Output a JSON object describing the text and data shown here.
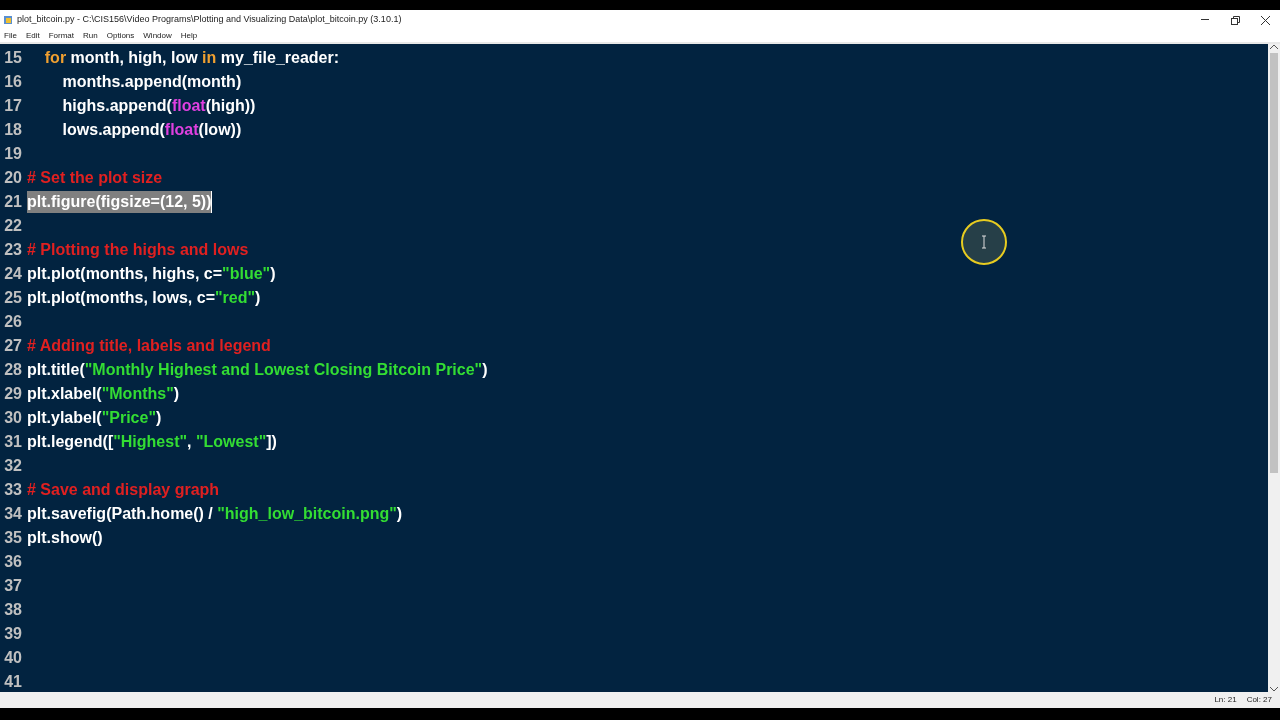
{
  "window": {
    "title": "plot_bitcoin.py - C:\\CIS156\\Video Programs\\Plotting and Visualizing Data\\plot_bitcoin.py (3.10.1)"
  },
  "menu": [
    "File",
    "Edit",
    "Format",
    "Run",
    "Options",
    "Window",
    "Help"
  ],
  "lines": [
    {
      "number": "15",
      "selected": false,
      "tokens": [
        {
          "kind": "keyword",
          "text": "    for"
        },
        {
          "kind": "plain",
          "text": " month, high, low "
        },
        {
          "kind": "keyword",
          "text": "in"
        },
        {
          "kind": "plain",
          "text": " my_file_reader:"
        }
      ]
    },
    {
      "number": "16",
      "selected": false,
      "tokens": [
        {
          "kind": "plain",
          "text": "        months.append(month)"
        }
      ]
    },
    {
      "number": "17",
      "selected": false,
      "tokens": [
        {
          "kind": "plain",
          "text": "        highs.append("
        },
        {
          "kind": "builtin",
          "text": "float"
        },
        {
          "kind": "plain",
          "text": "(high))"
        }
      ]
    },
    {
      "number": "18",
      "selected": false,
      "tokens": [
        {
          "kind": "plain",
          "text": "        lows.append("
        },
        {
          "kind": "builtin",
          "text": "float"
        },
        {
          "kind": "plain",
          "text": "(low))"
        }
      ]
    },
    {
      "number": "19",
      "selected": false
    },
    {
      "number": "20",
      "selected": false,
      "tokens": [
        {
          "kind": "comment",
          "text": "# Set the plot size"
        }
      ]
    },
    {
      "number": "21",
      "selected": true,
      "tokens": [
        {
          "kind": "plain",
          "text": "plt.figure(figsize=(12, 5))"
        }
      ]
    },
    {
      "number": "22",
      "selected": false
    },
    {
      "number": "23",
      "selected": false,
      "tokens": [
        {
          "kind": "comment",
          "text": "# Plotting the highs and lows"
        }
      ]
    },
    {
      "number": "24",
      "selected": false,
      "tokens": [
        {
          "kind": "plain",
          "text": "plt.plot(months, highs, c="
        },
        {
          "kind": "string",
          "text": "\"blue\""
        },
        {
          "kind": "plain",
          "text": ")"
        }
      ]
    },
    {
      "number": "25",
      "selected": false,
      "tokens": [
        {
          "kind": "plain",
          "text": "plt.plot(months, lows, c="
        },
        {
          "kind": "string",
          "text": "\"red\""
        },
        {
          "kind": "plain",
          "text": ")"
        }
      ]
    },
    {
      "number": "26",
      "selected": false
    },
    {
      "number": "27",
      "selected": false,
      "tokens": [
        {
          "kind": "comment",
          "text": "# Adding title, labels and legend"
        }
      ]
    },
    {
      "number": "28",
      "selected": false,
      "tokens": [
        {
          "kind": "plain",
          "text": "plt.title("
        },
        {
          "kind": "string",
          "text": "\"Monthly Highest and Lowest Closing Bitcoin Price\""
        },
        {
          "kind": "plain",
          "text": ")"
        }
      ]
    },
    {
      "number": "29",
      "selected": false,
      "tokens": [
        {
          "kind": "plain",
          "text": "plt.xlabel("
        },
        {
          "kind": "string",
          "text": "\"Months\""
        },
        {
          "kind": "plain",
          "text": ")"
        }
      ]
    },
    {
      "number": "30",
      "selected": false,
      "tokens": [
        {
          "kind": "plain",
          "text": "plt.ylabel("
        },
        {
          "kind": "string",
          "text": "\"Price\""
        },
        {
          "kind": "plain",
          "text": ")"
        }
      ]
    },
    {
      "number": "31",
      "selected": false,
      "tokens": [
        {
          "kind": "plain",
          "text": "plt.legend(["
        },
        {
          "kind": "string",
          "text": "\"Highest\""
        },
        {
          "kind": "plain",
          "text": ", "
        },
        {
          "kind": "string",
          "text": "\"Lowest\""
        },
        {
          "kind": "plain",
          "text": "])"
        }
      ]
    },
    {
      "number": "32",
      "selected": false
    },
    {
      "number": "33",
      "selected": false,
      "tokens": [
        {
          "kind": "comment",
          "text": "# Save and display graph"
        }
      ]
    },
    {
      "number": "34",
      "selected": false,
      "tokens": [
        {
          "kind": "plain",
          "text": "plt.savefig(Path.home() / "
        },
        {
          "kind": "string",
          "text": "\"high_low_bitcoin.png\""
        },
        {
          "kind": "plain",
          "text": ")"
        }
      ]
    },
    {
      "number": "35",
      "selected": false,
      "tokens": [
        {
          "kind": "plain",
          "text": "plt.show()"
        }
      ]
    },
    {
      "number": "36",
      "selected": false
    },
    {
      "number": "37",
      "selected": false
    },
    {
      "number": "38",
      "selected": false
    },
    {
      "number": "39",
      "selected": false
    },
    {
      "number": "40",
      "selected": false
    },
    {
      "number": "41",
      "selected": false
    }
  ],
  "status_bar": {
    "line": "Ln: 21",
    "column": "Col: 27"
  }
}
